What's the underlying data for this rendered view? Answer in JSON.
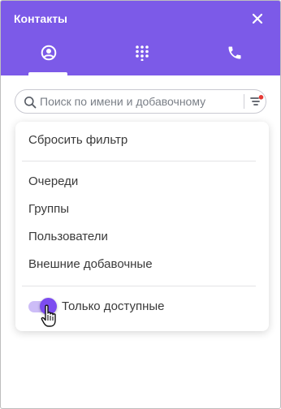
{
  "window": {
    "title": "Контакты"
  },
  "tabs": [
    {
      "id": "contacts",
      "icon": "account-circle-icon",
      "active": true
    },
    {
      "id": "dialpad",
      "icon": "dialpad-icon",
      "active": false
    },
    {
      "id": "calls",
      "icon": "phone-icon",
      "active": false
    }
  ],
  "search": {
    "placeholder": "Поиск по имени и добавочному",
    "value": ""
  },
  "filter": {
    "has_active_indicator": true,
    "indicator_color": "#e53935"
  },
  "menu": {
    "reset_label": "Сбросить фильтр",
    "items": [
      {
        "label": "Очереди"
      },
      {
        "label": "Группы"
      },
      {
        "label": "Пользователи"
      },
      {
        "label": "Внешние добавочные"
      }
    ],
    "toggle": {
      "label": "Только доступные",
      "on": true
    }
  },
  "colors": {
    "accent": "#7c5ae8",
    "toggle_knob": "#7c4cf0"
  }
}
